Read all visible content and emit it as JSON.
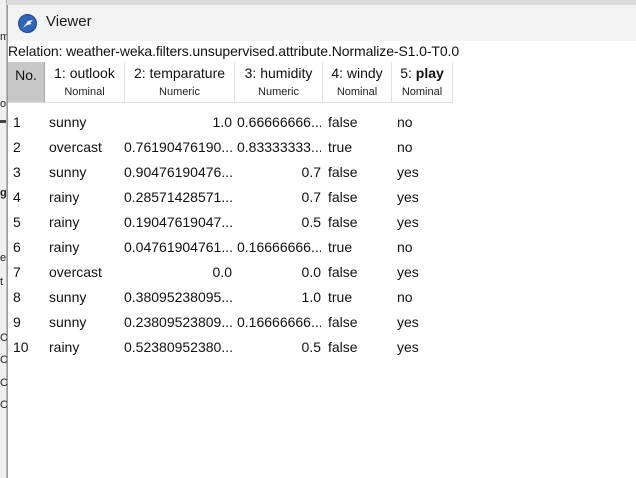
{
  "window": {
    "title": "Viewer",
    "relation": "Relation: weather-weka.filters.unsupervised.attribute.Normalize-S1.0-T0.0"
  },
  "table": {
    "columns": [
      {
        "index": "No.",
        "name": "",
        "type": ""
      },
      {
        "index": "1:",
        "name": "outlook",
        "type": "Nominal"
      },
      {
        "index": "2:",
        "name": "temparature",
        "type": "Numeric"
      },
      {
        "index": "3:",
        "name": "humidity",
        "type": "Numeric"
      },
      {
        "index": "4:",
        "name": "windy",
        "type": "Nominal"
      },
      {
        "index": "5:",
        "name": "play",
        "type": "Nominal"
      }
    ],
    "rows": [
      {
        "no": "1",
        "outlook": "sunny",
        "temp": "1.0",
        "humidity": "0.66666666...",
        "windy": "false",
        "play": "no"
      },
      {
        "no": "2",
        "outlook": "overcast",
        "temp": "0.76190476190...",
        "humidity": "0.83333333...",
        "windy": "true",
        "play": "no"
      },
      {
        "no": "3",
        "outlook": "sunny",
        "temp": "0.90476190476...",
        "humidity": "0.7",
        "windy": "false",
        "play": "yes"
      },
      {
        "no": "4",
        "outlook": "rainy",
        "temp": "0.28571428571...",
        "humidity": "0.7",
        "windy": "false",
        "play": "yes"
      },
      {
        "no": "5",
        "outlook": "rainy",
        "temp": "0.19047619047...",
        "humidity": "0.5",
        "windy": "false",
        "play": "yes"
      },
      {
        "no": "6",
        "outlook": "rainy",
        "temp": "0.04761904761...",
        "humidity": "0.16666666...",
        "windy": "true",
        "play": "no"
      },
      {
        "no": "7",
        "outlook": "overcast",
        "temp": "0.0",
        "humidity": "0.0",
        "windy": "false",
        "play": "yes"
      },
      {
        "no": "8",
        "outlook": "sunny",
        "temp": "0.38095238095...",
        "humidity": "1.0",
        "windy": "true",
        "play": "no"
      },
      {
        "no": "9",
        "outlook": "sunny",
        "temp": "0.23809523809...",
        "humidity": "0.16666666...",
        "windy": "false",
        "play": "yes"
      },
      {
        "no": "10",
        "outlook": "rainy",
        "temp": "0.52380952380...",
        "humidity": "0.5",
        "windy": "false",
        "play": "yes"
      }
    ]
  },
  "background_fragments": [
    "m",
    "o",
    "g",
    "er",
    "t",
    "C",
    "C",
    "C",
    "C"
  ]
}
